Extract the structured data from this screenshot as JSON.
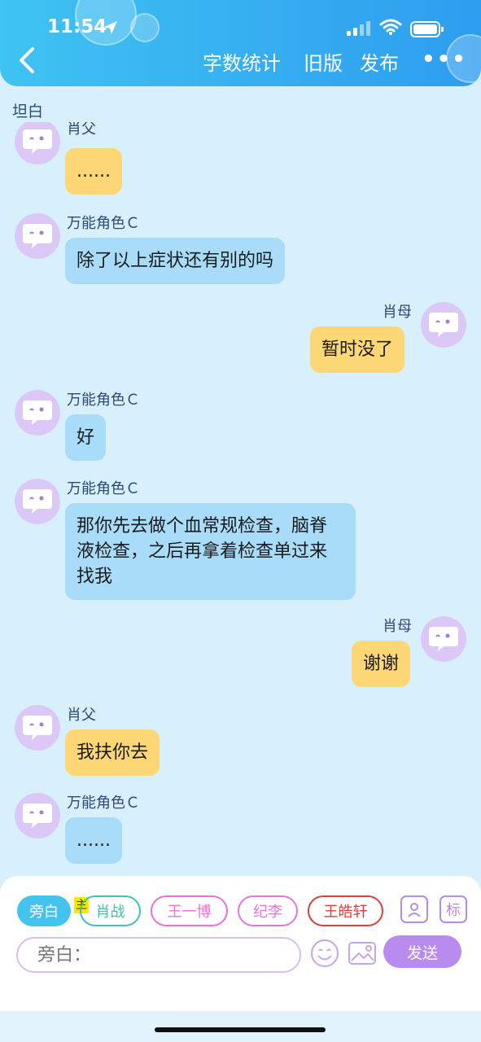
{
  "status_bar": {
    "time": "11:54"
  },
  "header": {
    "links": [
      "字数统计",
      "旧版",
      "发布"
    ],
    "more": "•••"
  },
  "chat_title": "坦白",
  "messages": [
    {
      "side": "left",
      "name": "肖父",
      "text": "......",
      "color": "yellow"
    },
    {
      "side": "left",
      "name": "万能角色Ｃ",
      "text": "除了以上症状还有别的吗",
      "color": "blue"
    },
    {
      "side": "right",
      "name": "肖母",
      "text": "暂时没了",
      "color": "yellow"
    },
    {
      "side": "left",
      "name": "万能角色Ｃ",
      "text": "好",
      "color": "blue"
    },
    {
      "side": "left",
      "name": "万能角色Ｃ",
      "text": "那你先去做个血常规检查，脑脊液检查，之后再拿着检查单过来找我",
      "color": "blue"
    },
    {
      "side": "right",
      "name": "肖母",
      "text": "谢谢",
      "color": "yellow"
    },
    {
      "side": "left",
      "name": "肖父",
      "text": "我扶你去",
      "color": "yellow"
    },
    {
      "side": "left",
      "name": "万能角色Ｃ",
      "text": "......",
      "color": "blue"
    }
  ],
  "roles": {
    "narration": "旁白",
    "main_badge": "主",
    "items": [
      "肖战",
      "王一博",
      "纪李",
      "王皓轩"
    ]
  },
  "buttons": {
    "mark": "标",
    "send": "发送"
  },
  "input": {
    "placeholder": "旁白："
  },
  "colors": {
    "header_start": "#3fc3f2",
    "header_end": "#2e9df0",
    "bubble_blue": "#a8dcf8",
    "bubble_yellow": "#fdd775",
    "send": "#b88cee"
  }
}
